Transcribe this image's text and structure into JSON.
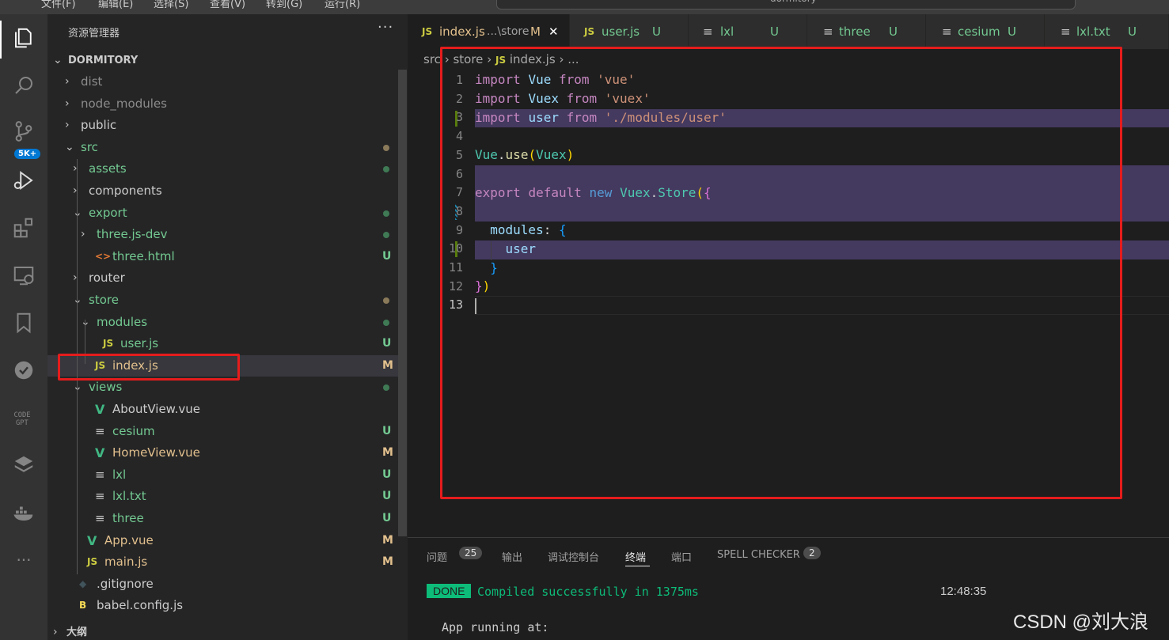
{
  "menu": [
    "文件(F)",
    "编辑(E)",
    "选择(S)",
    "查看(V)",
    "转到(G)",
    "运行(R)"
  ],
  "command_center": "dormitory",
  "activity": {
    "source_control_badge": "5K+"
  },
  "explorer": {
    "title": "资源管理器",
    "more": "···",
    "root": "DORMITORY",
    "items": [
      {
        "label": "dist",
        "status": "",
        "kind": "folder"
      },
      {
        "label": "node_modules",
        "status": "",
        "kind": "folder"
      },
      {
        "label": "public",
        "status": "",
        "kind": "folder"
      },
      {
        "label": "src",
        "status": "●",
        "kind": "folder-open"
      },
      {
        "label": "assets",
        "status": "●",
        "kind": "folder"
      },
      {
        "label": "components",
        "status": "",
        "kind": "folder"
      },
      {
        "label": "export",
        "status": "●",
        "kind": "folder-open"
      },
      {
        "label": "three.js-dev",
        "status": "●",
        "kind": "folder"
      },
      {
        "label": "three.html",
        "status": "U",
        "kind": "html"
      },
      {
        "label": "router",
        "status": "",
        "kind": "folder"
      },
      {
        "label": "store",
        "status": "●",
        "kind": "folder-open"
      },
      {
        "label": "modules",
        "status": "●",
        "kind": "folder-open"
      },
      {
        "label": "user.js",
        "status": "U",
        "kind": "js"
      },
      {
        "label": "index.js",
        "status": "M",
        "kind": "js"
      },
      {
        "label": "views",
        "status": "●",
        "kind": "folder-open"
      },
      {
        "label": "AboutView.vue",
        "status": "",
        "kind": "vue"
      },
      {
        "label": "cesium",
        "status": "U",
        "kind": "txt"
      },
      {
        "label": "HomeView.vue",
        "status": "M",
        "kind": "vue"
      },
      {
        "label": "lxl",
        "status": "U",
        "kind": "txt"
      },
      {
        "label": "lxl.txt",
        "status": "U",
        "kind": "txt"
      },
      {
        "label": "three",
        "status": "U",
        "kind": "txt"
      },
      {
        "label": "App.vue",
        "status": "M",
        "kind": "vue"
      },
      {
        "label": "main.js",
        "status": "M",
        "kind": "js"
      },
      {
        "label": ".gitignore",
        "status": "",
        "kind": "git"
      },
      {
        "label": "babel.config.js",
        "status": "",
        "kind": "babel"
      }
    ],
    "outline": "大纲"
  },
  "tabs": [
    {
      "icon": "JS",
      "label": "index.js",
      "desc": "...\\store",
      "status": "M",
      "close": "✕"
    },
    {
      "icon": "JS",
      "label": "user.js",
      "status": "U"
    },
    {
      "icon": "≡",
      "label": "lxl",
      "status": "U"
    },
    {
      "icon": "≡",
      "label": "three",
      "status": "U"
    },
    {
      "icon": "≡",
      "label": "cesium",
      "status": "U"
    },
    {
      "icon": "≡",
      "label": "lxl.txt",
      "status": "U"
    }
  ],
  "breadcrumb": {
    "p1": "src",
    "p2": "store",
    "icon": "JS",
    "p3": "index.js",
    "p4": "..."
  },
  "code": {
    "line_numbers": [
      "1",
      "2",
      "3",
      "4",
      "5",
      "6",
      "7",
      "8",
      "9",
      "10",
      "11",
      "12",
      "13"
    ]
  },
  "panel": {
    "tabs": [
      "问题",
      "输出",
      "调试控制台",
      "终端",
      "端口",
      "SPELL CHECKER"
    ],
    "problems_count": "25",
    "spell_count": "2",
    "done": "DONE",
    "compiled": "Compiled successfully in 1375ms",
    "time": "12:48:35",
    "running": "App running at:"
  },
  "watermark": "CSDN @刘大浪",
  "colors": {
    "accent": "#0078d4",
    "highlight": "#e51c1c",
    "untracked": "#73c991",
    "modified": "#e2c08d"
  }
}
